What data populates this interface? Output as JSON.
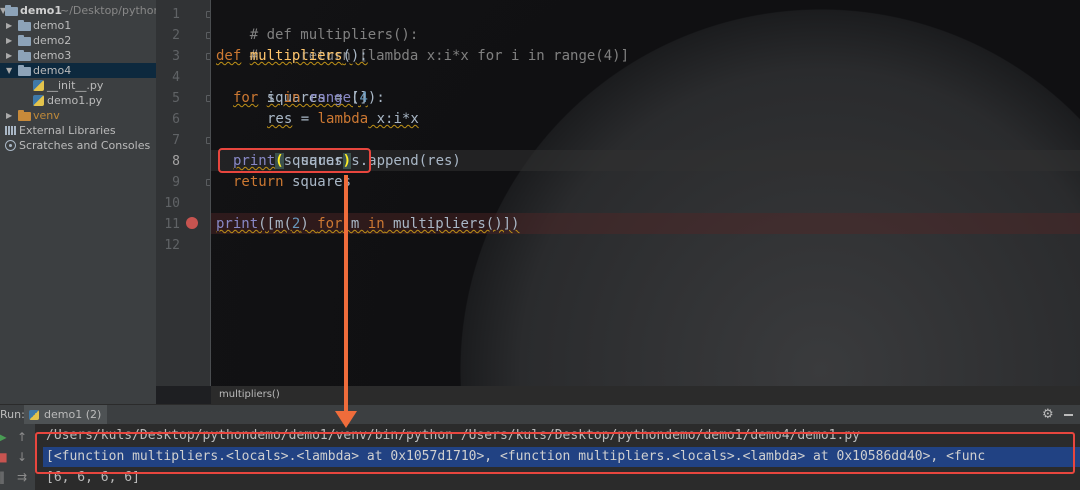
{
  "project": {
    "name": "demo1",
    "path": "~/Desktop/pythonde",
    "items": [
      {
        "label": "demo1",
        "kind": "folder",
        "expanded": false
      },
      {
        "label": "demo2",
        "kind": "folder",
        "expanded": false
      },
      {
        "label": "demo3",
        "kind": "folder",
        "expanded": false
      },
      {
        "label": "demo4",
        "kind": "folder",
        "expanded": true,
        "selected": true
      },
      {
        "label": "__init__.py",
        "kind": "python-file"
      },
      {
        "label": "demo1.py",
        "kind": "python-file"
      },
      {
        "label": "venv",
        "kind": "excluded-folder",
        "expanded": false
      },
      {
        "label": "External Libraries",
        "kind": "libraries"
      },
      {
        "label": "Scratches and Consoles",
        "kind": "scratches"
      }
    ]
  },
  "editor": {
    "line_numbers": [
      "1",
      "2",
      "3",
      "4",
      "5",
      "6",
      "7",
      "8",
      "9",
      "10",
      "11",
      "12"
    ],
    "current_line": "8",
    "breakpoint_line": "11",
    "code": {
      "l1": "# def multipliers():",
      "l2": "#     return [lambda x:i*x for i in range(4)]",
      "l3_def": "def",
      "l3_name": "multipliers",
      "l3_rest": "():",
      "l4": "squares = []",
      "l5_for": "for",
      "l5_i": " i ",
      "l5_in": "in",
      "l5_range": "range",
      "l5_open": "(",
      "l5_num": "4",
      "l5_close": "):",
      "l6_res": "res",
      "l6_eq": " = ",
      "l6_lambda": "lambda",
      "l6_rest": " x:i*x",
      "l7": "squares.append(res)",
      "l8_print": "print",
      "l8_open": "(",
      "l8_arg": "squares",
      "l8_close": ")",
      "l9_return": "return",
      "l9_rest": " squares",
      "l11_print": "print",
      "l11_a": "([m(",
      "l11_num": "2",
      "l11_b": ") ",
      "l11_for": "for",
      "l11_c": " m ",
      "l11_in": "in",
      "l11_d": " multipliers()])"
    },
    "breadcrumb": "multipliers()"
  },
  "run": {
    "label": "Run:",
    "tab": "demo1 (2)",
    "output": [
      "/Users/kuls/Desktop/pythondemo/demo1/venv/bin/python /Users/kuls/Desktop/pythondemo/demo1/demo4/demo1.py",
      "[<function multipliers.<locals>.<lambda> at 0x1057d1710>, <function multipliers.<locals>.<lambda> at 0x10586dd40>, <func",
      "[6, 6, 6, 6]"
    ]
  },
  "colors": {
    "annotation": "#e8463e",
    "arrow": "#ef6c3b",
    "keyword": "#cc7832",
    "function_name": "#ffc66d",
    "number": "#6897bb",
    "selection": "#214283"
  }
}
